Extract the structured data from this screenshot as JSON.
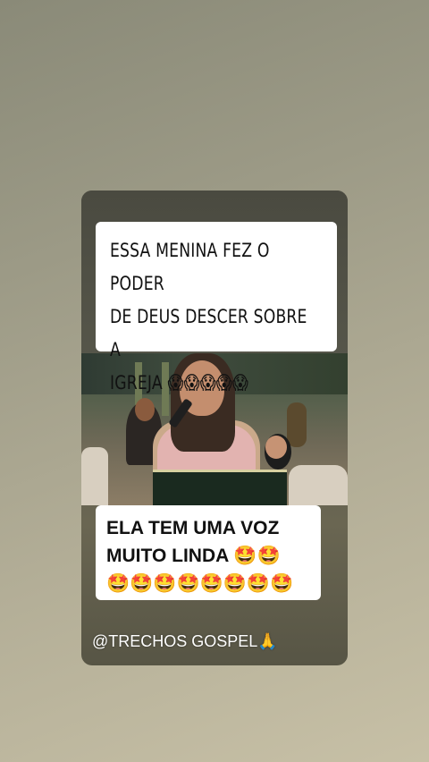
{
  "story": {
    "caption_top": {
      "line1": "ESSA MENINA FEZ O PODER",
      "line2": "DE DEUS DESCER SOBRE A",
      "line3_text": "IGREJA",
      "line3_emojis": "😱😱😱😱😱"
    },
    "caption_bottom": {
      "line1": "ELA TEM UMA VOZ",
      "line2_text": "MUITO LINDA",
      "line2_emojis": "🤩🤩",
      "line3_emojis": "🤩🤩🤩🤩🤩🤩🤩🤩"
    },
    "handle": "@TRECHOS GOSPEL🙏"
  },
  "colors": {
    "card_bg": "#56564a",
    "caption_bg": "#ffffff",
    "caption_text": "#111111"
  }
}
